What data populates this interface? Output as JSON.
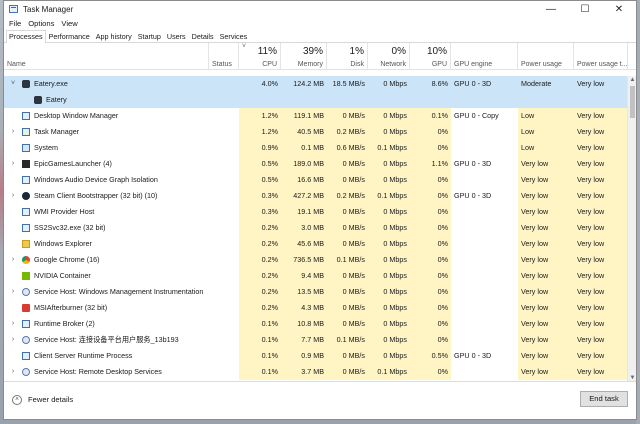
{
  "window": {
    "title": "Task Manager",
    "minimize_glyph": "—",
    "maximize_glyph": "☐",
    "close_glyph": "✕"
  },
  "menu": [
    "File",
    "Options",
    "View"
  ],
  "tabs": [
    {
      "label": "Processes",
      "active": true
    },
    {
      "label": "Performance"
    },
    {
      "label": "App history"
    },
    {
      "label": "Startup"
    },
    {
      "label": "Users"
    },
    {
      "label": "Details"
    },
    {
      "label": "Services"
    }
  ],
  "columns": {
    "name": "Name",
    "status": "Status",
    "cpu": {
      "pct": "11%",
      "label": "CPU",
      "sort_glyph": "˅"
    },
    "memory": {
      "pct": "39%",
      "label": "Memory"
    },
    "disk": {
      "pct": "1%",
      "label": "Disk"
    },
    "network": {
      "pct": "0%",
      "label": "Network"
    },
    "gpu": {
      "pct": "10%",
      "label": "GPU"
    },
    "gpu_engine": "GPU engine",
    "power": "Power usage",
    "power_trend": "Power usage t..."
  },
  "rows": [
    {
      "expand": "˅",
      "icon": "eatery-icon",
      "name": "Eatery.exe",
      "status": "",
      "cpu": "4.0%",
      "mem": "124.2 MB",
      "disk": "18.5 MB/s",
      "net": "0 Mbps",
      "gpu": "8.6%",
      "engine": "GPU 0 - 3D",
      "power": "Moderate",
      "trend": "Very low",
      "selected": true,
      "indent": 0
    },
    {
      "expand": "",
      "icon": "eatery-icon",
      "name": "Eatery",
      "status": "",
      "cpu": "",
      "mem": "",
      "disk": "",
      "net": "",
      "gpu": "",
      "engine": "",
      "power": "",
      "trend": "",
      "selected": true,
      "indent": 1
    },
    {
      "expand": "",
      "icon": "window-icon",
      "name": "Desktop Window Manager",
      "cpu": "1.2%",
      "mem": "119.1 MB",
      "disk": "0 MB/s",
      "net": "0 Mbps",
      "gpu": "0.1%",
      "engine": "GPU 0 - Copy",
      "power": "Low",
      "trend": "Very low",
      "indent": 0
    },
    {
      "expand": "›",
      "icon": "taskmgr-icon",
      "name": "Task Manager",
      "cpu": "1.2%",
      "mem": "40.5 MB",
      "disk": "0.2 MB/s",
      "net": "0 Mbps",
      "gpu": "0%",
      "engine": "",
      "power": "Low",
      "trend": "Very low",
      "indent": 0
    },
    {
      "expand": "",
      "icon": "system-icon",
      "name": "System",
      "cpu": "0.9%",
      "mem": "0.1 MB",
      "disk": "0.6 MB/s",
      "net": "0.1 Mbps",
      "gpu": "0%",
      "engine": "",
      "power": "Low",
      "trend": "Very low",
      "indent": 0
    },
    {
      "expand": "›",
      "icon": "epic-icon",
      "name": "EpicGamesLauncher (4)",
      "cpu": "0.5%",
      "mem": "189.0 MB",
      "disk": "0 MB/s",
      "net": "0 Mbps",
      "gpu": "1.1%",
      "engine": "GPU 0 - 3D",
      "power": "Very low",
      "trend": "Very low",
      "indent": 0
    },
    {
      "expand": "",
      "icon": "window-icon",
      "name": "Windows Audio Device Graph Isolation",
      "cpu": "0.5%",
      "mem": "16.6 MB",
      "disk": "0 MB/s",
      "net": "0 Mbps",
      "gpu": "0%",
      "engine": "",
      "power": "Very low",
      "trend": "Very low",
      "indent": 0
    },
    {
      "expand": "›",
      "icon": "steam-icon",
      "name": "Steam Client Bootstrapper (32 bit) (10)",
      "cpu": "0.3%",
      "mem": "427.2 MB",
      "disk": "0.2 MB/s",
      "net": "0.1 Mbps",
      "gpu": "0%",
      "engine": "GPU 0 - 3D",
      "power": "Very low",
      "trend": "Very low",
      "indent": 0
    },
    {
      "expand": "",
      "icon": "window-icon",
      "name": "WMI Provider Host",
      "cpu": "0.3%",
      "mem": "19.1 MB",
      "disk": "0 MB/s",
      "net": "0 Mbps",
      "gpu": "0%",
      "engine": "",
      "power": "Very low",
      "trend": "Very low",
      "indent": 0
    },
    {
      "expand": "",
      "icon": "window-icon",
      "name": "SS2Svc32.exe (32 bit)",
      "cpu": "0.2%",
      "mem": "3.0 MB",
      "disk": "0 MB/s",
      "net": "0 Mbps",
      "gpu": "0%",
      "engine": "",
      "power": "Very low",
      "trend": "Very low",
      "indent": 0
    },
    {
      "expand": "",
      "icon": "folder-icon",
      "name": "Windows Explorer",
      "cpu": "0.2%",
      "mem": "45.6 MB",
      "disk": "0 MB/s",
      "net": "0 Mbps",
      "gpu": "0%",
      "engine": "",
      "power": "Very low",
      "trend": "Very low",
      "indent": 0
    },
    {
      "expand": "›",
      "icon": "chrome-icon",
      "name": "Google Chrome (16)",
      "cpu": "0.2%",
      "mem": "736.5 MB",
      "disk": "0.1 MB/s",
      "net": "0 Mbps",
      "gpu": "0%",
      "engine": "",
      "power": "Very low",
      "trend": "Very low",
      "indent": 0
    },
    {
      "expand": "",
      "icon": "nvidia-icon",
      "name": "NVIDIA Container",
      "cpu": "0.2%",
      "mem": "9.4 MB",
      "disk": "0 MB/s",
      "net": "0 Mbps",
      "gpu": "0%",
      "engine": "",
      "power": "Very low",
      "trend": "Very low",
      "indent": 0
    },
    {
      "expand": "›",
      "icon": "gear-icon",
      "name": "Service Host: Windows Management Instrumentation",
      "cpu": "0.2%",
      "mem": "13.5 MB",
      "disk": "0 MB/s",
      "net": "0 Mbps",
      "gpu": "0%",
      "engine": "",
      "power": "Very low",
      "trend": "Very low",
      "indent": 0
    },
    {
      "expand": "",
      "icon": "afterburner-icon",
      "name": "MSIAfterburner (32 bit)",
      "cpu": "0.2%",
      "mem": "4.3 MB",
      "disk": "0 MB/s",
      "net": "0 Mbps",
      "gpu": "0%",
      "engine": "",
      "power": "Very low",
      "trend": "Very low",
      "indent": 0
    },
    {
      "expand": "›",
      "icon": "window-icon",
      "name": "Runtime Broker (2)",
      "cpu": "0.1%",
      "mem": "10.8 MB",
      "disk": "0 MB/s",
      "net": "0 Mbps",
      "gpu": "0%",
      "engine": "",
      "power": "Very low",
      "trend": "Very low",
      "indent": 0
    },
    {
      "expand": "›",
      "icon": "gear-icon",
      "name": "Service Host: 连接设备平台用户服务_13b193",
      "cpu": "0.1%",
      "mem": "7.7 MB",
      "disk": "0.1 MB/s",
      "net": "0 Mbps",
      "gpu": "0%",
      "engine": "",
      "power": "Very low",
      "trend": "Very low",
      "indent": 0
    },
    {
      "expand": "",
      "icon": "window-icon",
      "name": "Client Server Runtime Process",
      "cpu": "0.1%",
      "mem": "0.9 MB",
      "disk": "0 MB/s",
      "net": "0 Mbps",
      "gpu": "0.5%",
      "engine": "GPU 0 - 3D",
      "power": "Very low",
      "trend": "Very low",
      "indent": 0
    },
    {
      "expand": "›",
      "icon": "gear-icon",
      "name": "Service Host: Remote Desktop Services",
      "cpu": "0.1%",
      "mem": "3.7 MB",
      "disk": "0 MB/s",
      "net": "0.1 Mbps",
      "gpu": "0%",
      "engine": "",
      "power": "Very low",
      "trend": "Very low",
      "indent": 0
    }
  ],
  "footer": {
    "fewer_details": "Fewer details",
    "fewer_glyph": "˄",
    "end_task": "End task"
  },
  "colors": {
    "heat_light": "#fff4c4",
    "heat_mid": "#ffeaa0",
    "selected": "#cce4f7"
  }
}
